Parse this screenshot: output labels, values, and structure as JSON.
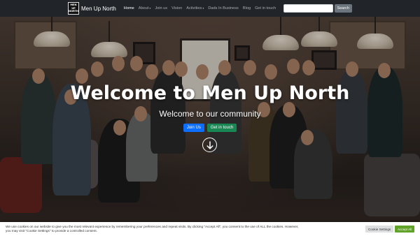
{
  "brand": {
    "logo_lines": [
      "MEN",
      "UP",
      "NORTH"
    ],
    "name": "Men Up North"
  },
  "nav": {
    "items": [
      {
        "label": "Home",
        "active": true,
        "dropdown": false
      },
      {
        "label": "About",
        "active": false,
        "dropdown": true
      },
      {
        "label": "Join us",
        "active": false,
        "dropdown": false
      },
      {
        "label": "Vision",
        "active": false,
        "dropdown": false
      },
      {
        "label": "Activities",
        "active": false,
        "dropdown": true
      },
      {
        "label": "Dads In Business",
        "active": false,
        "dropdown": false
      },
      {
        "label": "Blog",
        "active": false,
        "dropdown": false
      },
      {
        "label": "Get in touch",
        "active": false,
        "dropdown": false
      }
    ]
  },
  "search": {
    "placeholder": "",
    "value": "",
    "button_label": "Search"
  },
  "hero": {
    "title": "Welcome to Men Up North",
    "subtitle": "Welcome to our community",
    "primary_button": "Join Us",
    "secondary_button": "Get in touch",
    "scroll_icon": "arrow-down-circle-icon"
  },
  "cookie": {
    "text": "We use cookies on our website to give you the most relevant experience by remembering your preferences and repeat visits. By clicking “Accept All”, you consent to the use of ALL the cookies. However, you may visit \"Cookie Settings\" to provide a controlled consent.",
    "settings_label": "Cookie Settings",
    "accept_label": "Accept All"
  },
  "colors": {
    "navbar": "#212529",
    "primary": "#0d6efd",
    "success": "#198754",
    "accept": "#61a229"
  }
}
